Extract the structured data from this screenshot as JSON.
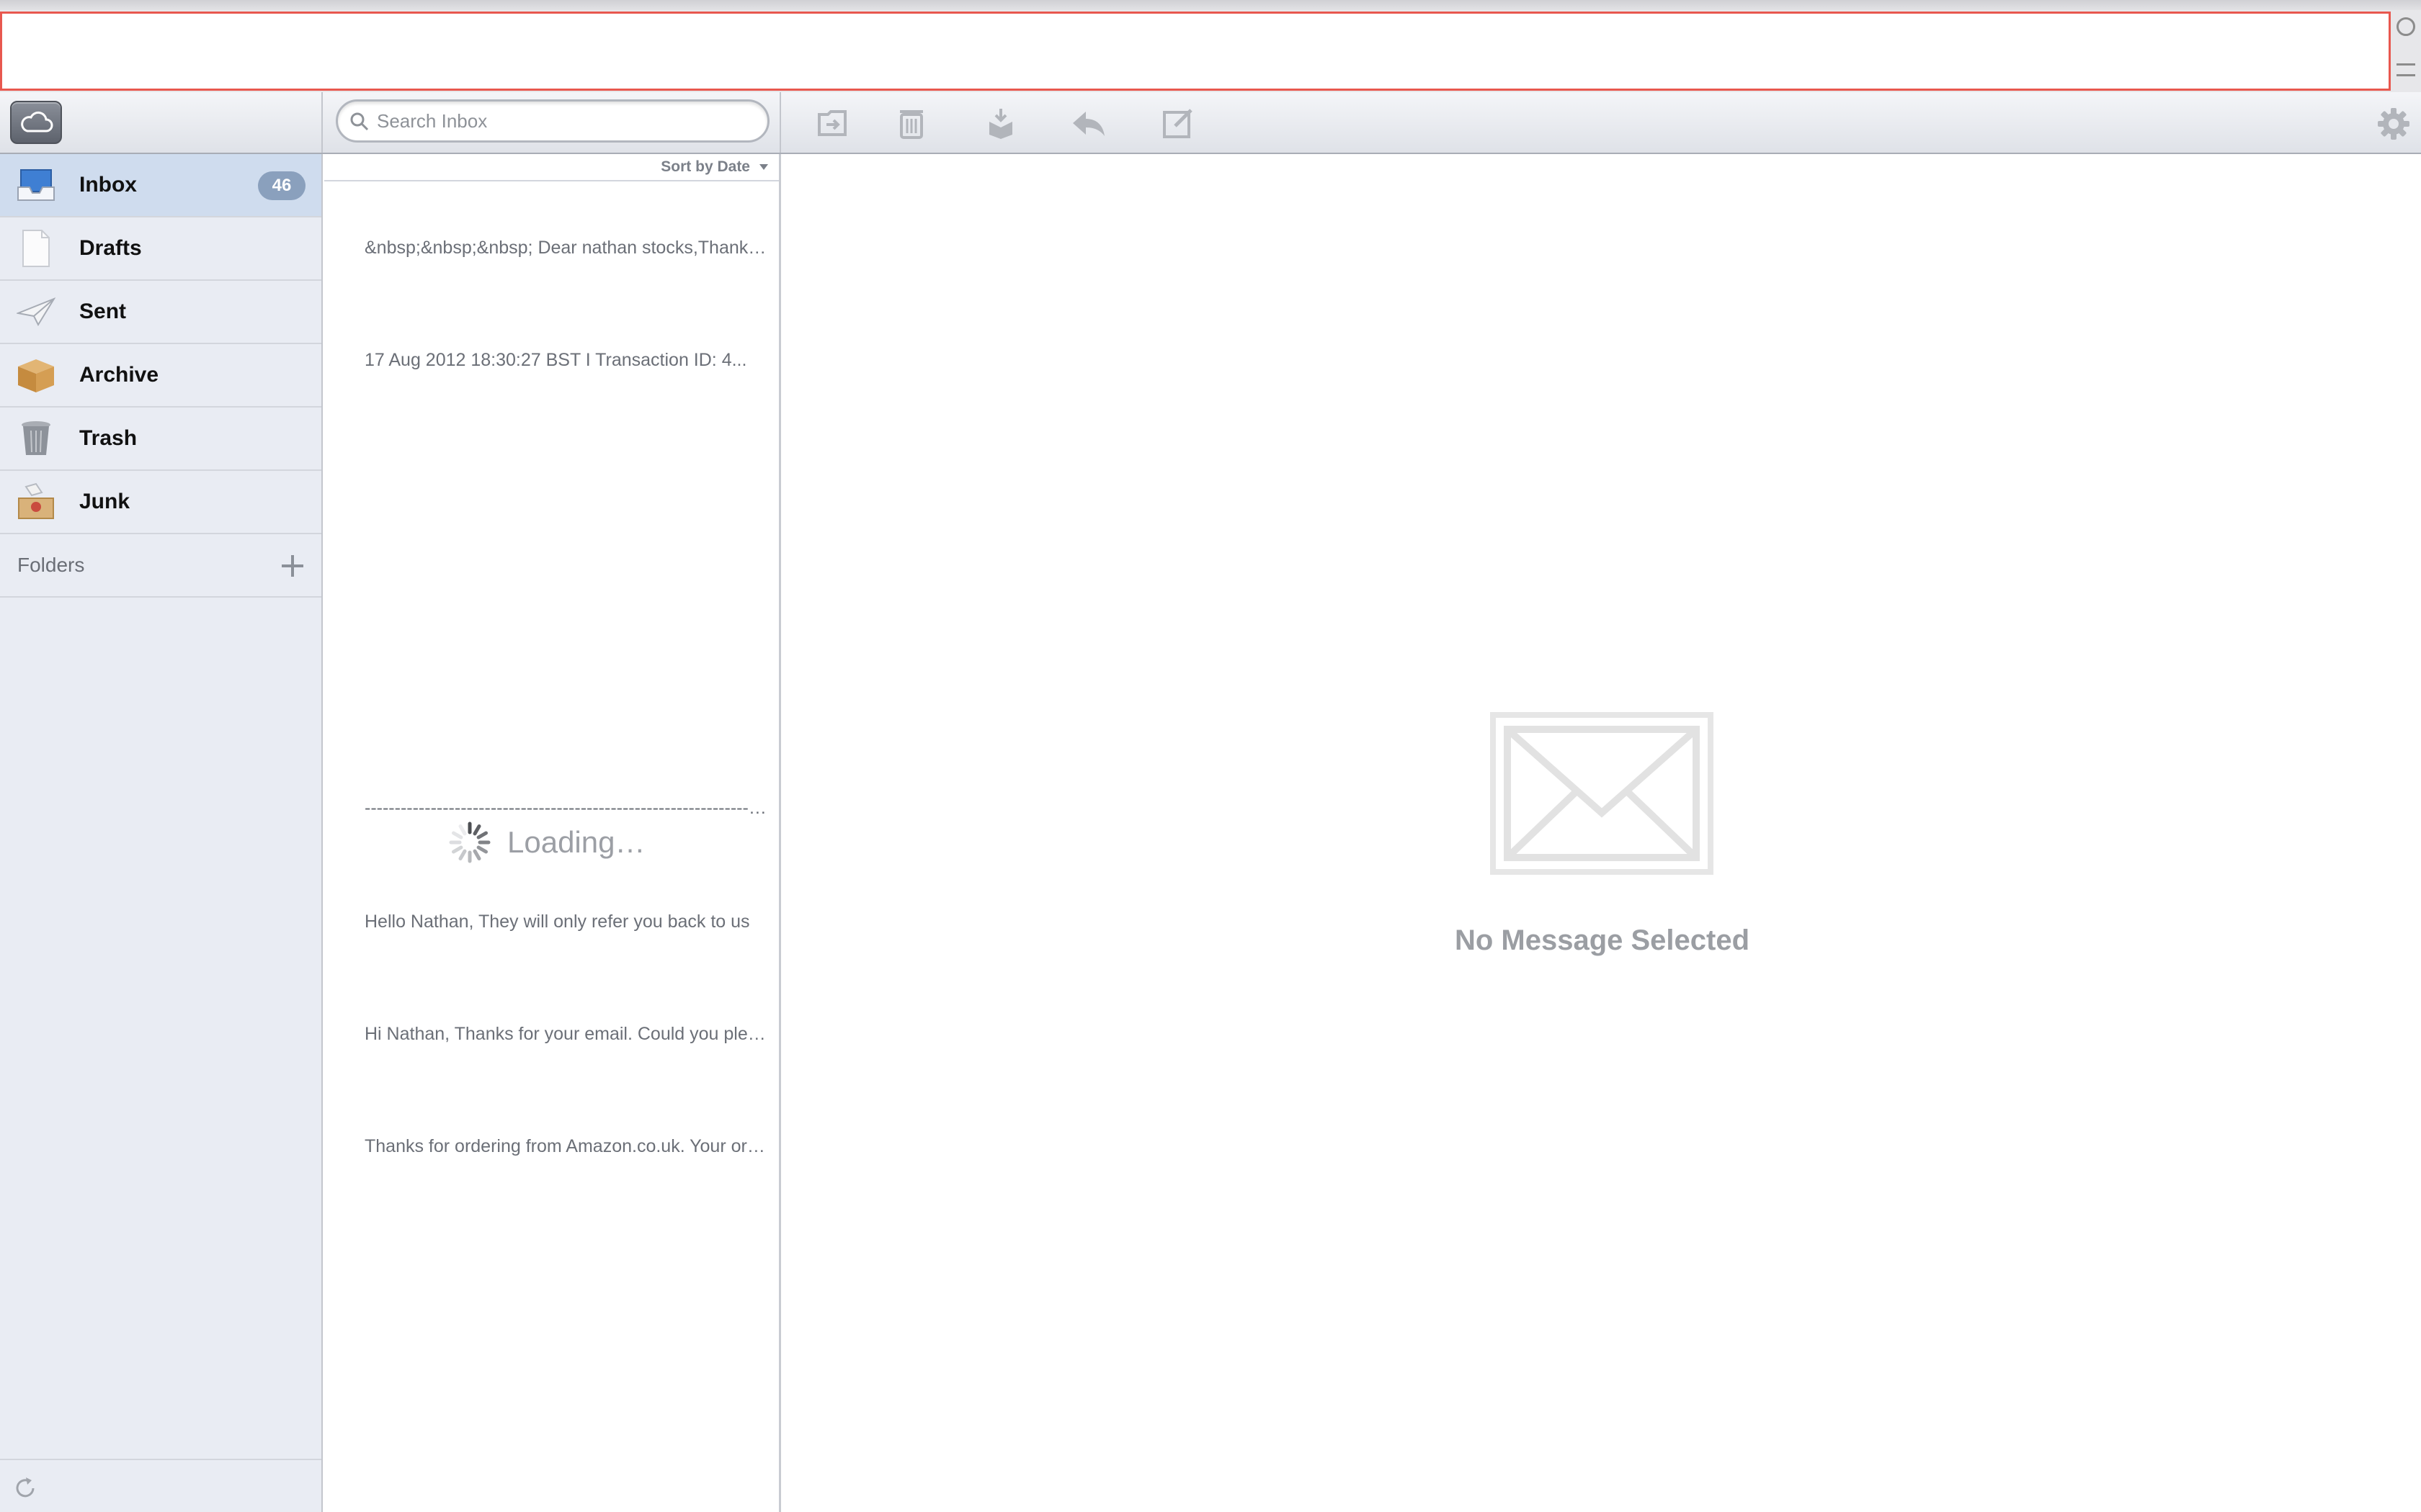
{
  "search": {
    "placeholder": "Search Inbox"
  },
  "mailboxes": [
    {
      "label": "Inbox",
      "badge": "46",
      "icon": "inbox-icon"
    },
    {
      "label": "Drafts",
      "icon": "drafts-icon"
    },
    {
      "label": "Sent",
      "icon": "sent-icon"
    },
    {
      "label": "Archive",
      "icon": "archive-box-icon"
    },
    {
      "label": "Trash",
      "icon": "trash-can-icon"
    },
    {
      "label": "Junk",
      "icon": "junk-icon"
    }
  ],
  "folders": {
    "label": "Folders"
  },
  "list": {
    "sort_label": "Sort by Date",
    "previews": [
      "&nbsp;&nbsp;&nbsp; Dear nathan stocks,Thank you for your order",
      "17 Aug 2012 18:30:27 BST I Transaction ID: 4...",
      "----------------------------------------------------------------------------------------",
      "Hello Nathan, They will only refer you back to us",
      "Hi Nathan, Thanks for your email. Could you please",
      "Thanks for ordering from Amazon.co.uk. Your order"
    ],
    "loading_text": "Loading…"
  },
  "reading_pane": {
    "empty_text": "No Message Selected"
  },
  "colors": {
    "accent": "#cfdcee",
    "badge": "#8aa0bd",
    "url_border": "#e8584f"
  }
}
